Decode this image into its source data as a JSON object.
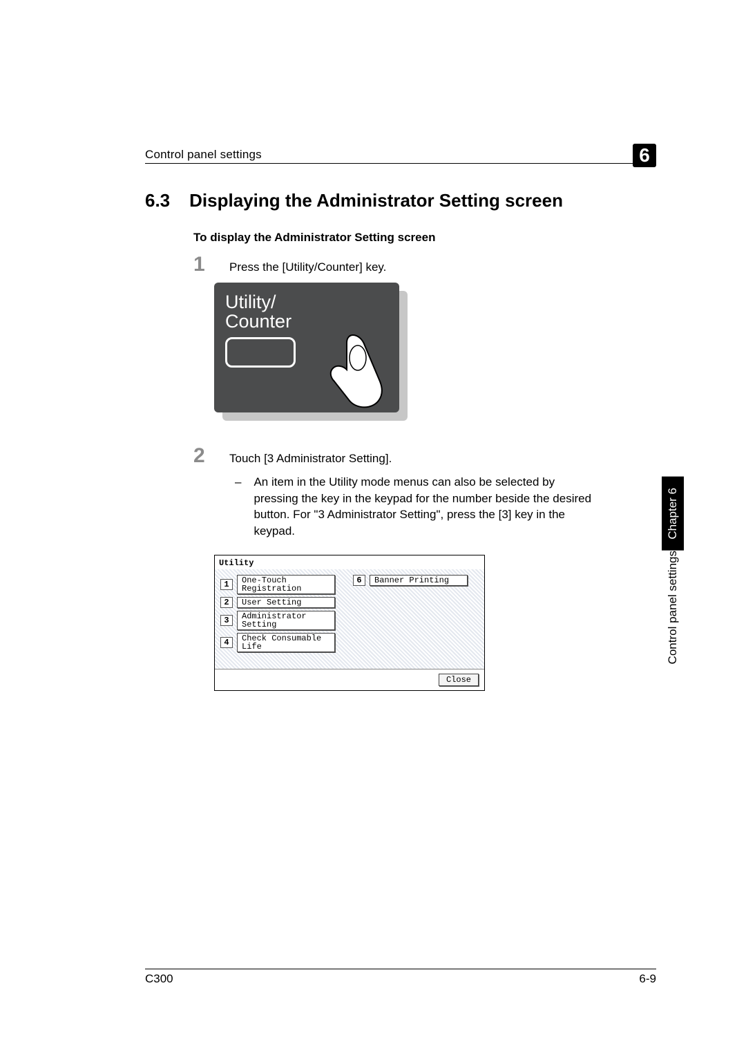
{
  "header": {
    "running_title": "Control panel settings",
    "chapter_number": "6"
  },
  "section": {
    "number": "6.3",
    "title": "Displaying the Administrator Setting screen"
  },
  "subheading": "To display the Administrator Setting screen",
  "steps": {
    "1": {
      "num": "1",
      "text": "Press the [Utility/Counter] key."
    },
    "2": {
      "num": "2",
      "text": "Touch [3 Administrator Setting].",
      "sub_dash": "–",
      "sub_text": "An item in the Utility mode menus can also be selected by pressing the key in the keypad for the number beside the desired button. For \"3 Administrator Setting\", press the [3] key in the keypad."
    }
  },
  "key_illustration": {
    "line1": "Utility/",
    "line2": "Counter"
  },
  "utility_screen": {
    "title": "Utility",
    "items": [
      {
        "num": "1",
        "label": "One-Touch\nRegistration"
      },
      {
        "num": "2",
        "label": "User Setting"
      },
      {
        "num": "3",
        "label": "Administrator\nSetting"
      },
      {
        "num": "4",
        "label": "Check Consumable\nLife"
      }
    ],
    "right_item": {
      "num": "6",
      "label": "Banner Printing"
    },
    "close": "Close"
  },
  "side_tab": {
    "chapter": "Chapter 6",
    "label": "Control panel settings"
  },
  "footer": {
    "model": "C300",
    "page": "6-9"
  }
}
